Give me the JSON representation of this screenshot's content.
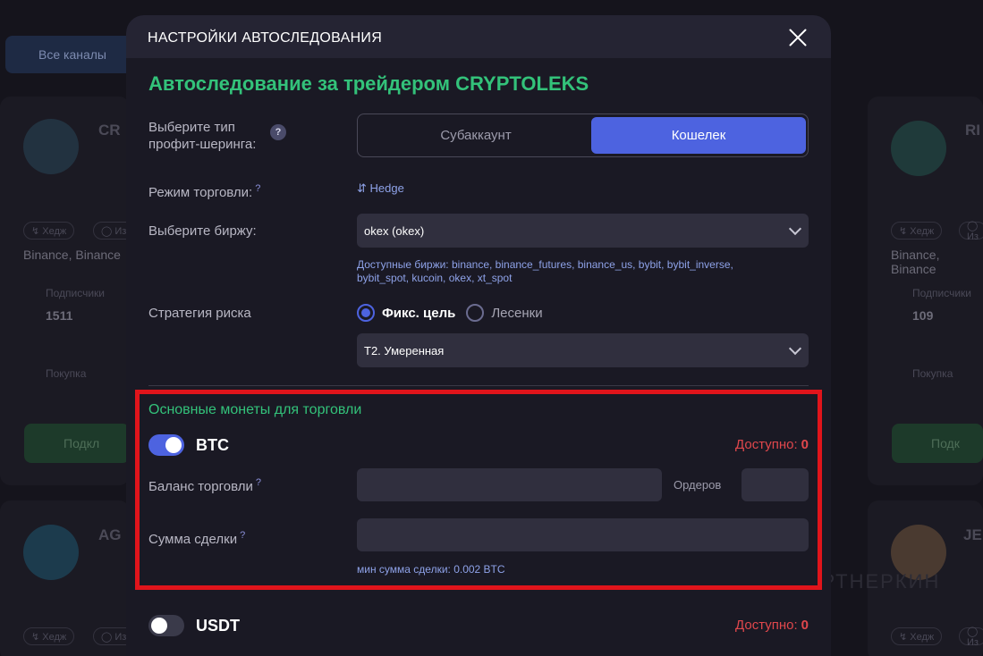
{
  "background": {
    "tab_label": "Все каналы",
    "left_card_top": {
      "name": "CR",
      "chips": [
        "↯ Хедж",
        "◯ Из"
      ],
      "exchanges": "Binance, Binance",
      "subscribers_label": "Подписчики",
      "subscribers_value": "1511",
      "buy_label": "Покупка",
      "button_label": "Подкл"
    },
    "right_card_top": {
      "name": "RI",
      "chips": [
        "↯ Хедж",
        "◯ Из"
      ],
      "exchanges": "Binance, Binance",
      "subscribers_label": "Подписчики",
      "subscribers_value": "109",
      "buy_label": "Покупка",
      "button_label": "Подк"
    },
    "left_card_bottom": {
      "name": "AG",
      "chips": [
        "↯ Хедж",
        "◯ Из"
      ]
    },
    "right_card_bottom": {
      "name": "JE",
      "chips": [
        "↯ Хедж",
        "◯ Из"
      ]
    },
    "watermark": "ПАРТНЕРКИН"
  },
  "modal": {
    "title": "НАСТРОЙКИ АВТОСЛЕДОВАНИЯ",
    "heading": "Автоследование за трейдером CRYPTOLEKS",
    "profit_sharing": {
      "label_line1": "Выберите тип",
      "label_line2": "профит-шеринга:",
      "help": "?",
      "options": [
        "Субаккаунт",
        "Кошелек"
      ],
      "selected": "Кошелек"
    },
    "trading_mode": {
      "label": "Режим торговли:",
      "help": "?",
      "value": "⇵ Hedge"
    },
    "exchange": {
      "label": "Выберите биржу:",
      "selected": "okex (okex)",
      "available": "Доступные биржи: binance, binance_futures, binance_us, bybit, bybit_inverse, bybit_spot, kucoin, okex, xt_spot"
    },
    "risk_strategy": {
      "label": "Стратегия риска",
      "options": [
        "Фикс. цель",
        "Лесенки"
      ],
      "selected": "Фикс. цель",
      "level": "T2. Умеренная"
    },
    "main_coins": {
      "title": "Основные монеты для торговли",
      "btc": {
        "name": "BTC",
        "enabled": true,
        "available_label": "Доступно:",
        "available_value": "0",
        "balance_label": "Баланс торговли",
        "balance_help": "?",
        "balance_value": "",
        "orders_label": "Ордеров",
        "orders_value": "",
        "deal_sum_label": "Сумма сделки",
        "deal_sum_help": "?",
        "deal_sum_value": "",
        "min_sum": "мин сумма сделки: 0.002 BTC"
      },
      "usdt": {
        "name": "USDT",
        "enabled": false,
        "available_label": "Доступно:",
        "available_value": "0"
      }
    }
  },
  "colors": {
    "accent_blue": "#4d63e0",
    "green": "#33c27a",
    "danger_red": "#e0474c",
    "highlight_box": "#e0141b"
  }
}
